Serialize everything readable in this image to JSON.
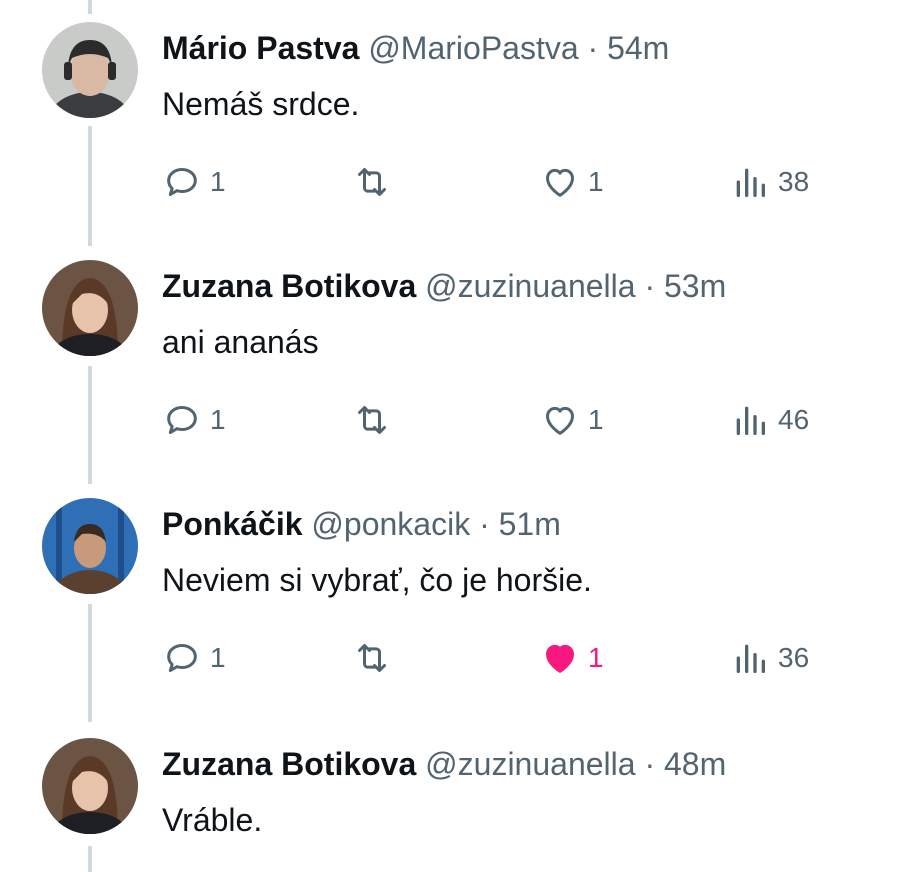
{
  "thread": [
    {
      "name": "Mário Pastva",
      "handle": "@MarioPastva",
      "separator": "·",
      "time": "54m",
      "text": "Nemáš srdce.",
      "reply_count": "1",
      "retweet_count": "",
      "like_count": "1",
      "liked": false,
      "view_count": "38",
      "avatar_colors": {
        "bg": "#c9cbc9",
        "skin": "#d9b9a4",
        "hair": "#2b2b2b",
        "shirt": "#3a3d3f"
      }
    },
    {
      "name": "Zuzana Botikova",
      "handle": "@zuzinuanella",
      "separator": "·",
      "time": "53m",
      "text": "ani ananás",
      "reply_count": "1",
      "retweet_count": "",
      "like_count": "1",
      "liked": false,
      "view_count": "46",
      "avatar_colors": {
        "bg": "#6b5443",
        "skin": "#e7c3ac",
        "hair": "#5a3a26",
        "shirt": "#1d1f24"
      }
    },
    {
      "name": "Ponkáčik",
      "handle": "@ponkacik",
      "separator": "·",
      "time": "51m",
      "text": "Neviem si vybrať, čo je horšie.",
      "reply_count": "1",
      "retweet_count": "",
      "like_count": "1",
      "liked": true,
      "view_count": "36",
      "avatar_colors": {
        "bg": "#2f6fb6",
        "skin": "#c89a7c",
        "hair": "#3b2a1f",
        "shirt": "#5b4030"
      }
    },
    {
      "name": "Zuzana Botikova",
      "handle": "@zuzinuanella",
      "separator": "·",
      "time": "48m",
      "text": "Vráble.",
      "avatar_colors": {
        "bg": "#6b5443",
        "skin": "#e7c3ac",
        "hair": "#5a3a26",
        "shirt": "#1d1f24"
      }
    }
  ],
  "icons": {
    "reply": "reply-icon",
    "retweet": "retweet-icon",
    "like": "heart-icon",
    "views": "views-icon"
  },
  "colors": {
    "text": "#0f1419",
    "muted": "#536471",
    "thread_line": "#cfd9de",
    "like_active": "#f91880"
  }
}
